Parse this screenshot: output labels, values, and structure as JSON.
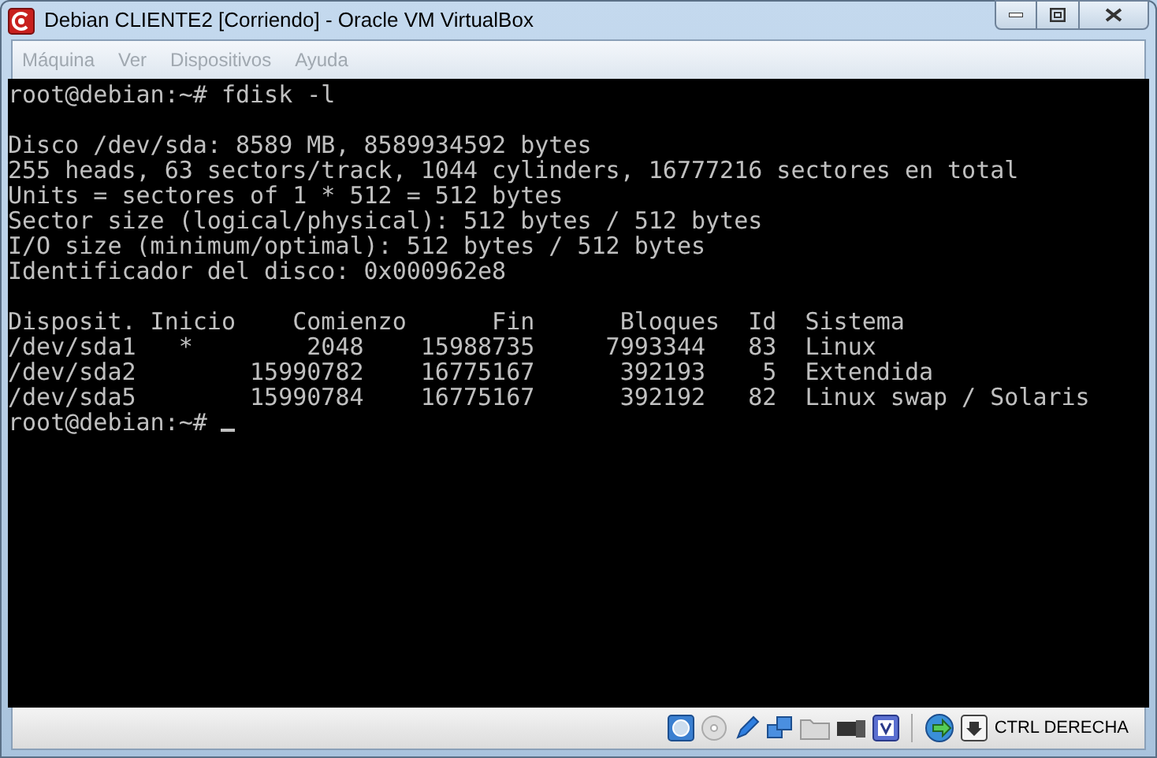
{
  "window": {
    "title": "Debian CLIENTE2 [Corriendo] - Oracle VM VirtualBox"
  },
  "menu": [
    {
      "label": "Máquina",
      "disabled": true
    },
    {
      "label": "Ver",
      "disabled": true
    },
    {
      "label": "Dispositivos",
      "disabled": true
    },
    {
      "label": "Ayuda",
      "disabled": true
    }
  ],
  "terminal": {
    "blocks": [
      [
        "root@debian:~# fdisk -l"
      ],
      [
        "Disco /dev/sda: 8589 MB, 8589934592 bytes",
        "255 heads, 63 sectors/track, 1044 cylinders, 16777216 sectores en total",
        "Units = sectores of 1 * 512 = 512 bytes",
        "Sector size (logical/physical): 512 bytes / 512 bytes",
        "I/O size (minimum/optimal): 512 bytes / 512 bytes",
        "Identificador del disco: 0x000962e8"
      ],
      [
        "Disposit. Inicio    Comienzo      Fin      Bloques  Id  Sistema",
        "/dev/sda1   *        2048    15988735     7993344   83  Linux",
        "/dev/sda2        15990782    16775167      392193    5  Extendida",
        "/dev/sda5        15990784    16775167      392192   82  Linux swap / Solaris",
        "root@debian:~# "
      ]
    ],
    "cursor": true
  },
  "status_bar": {
    "host_key": "CTRL DERECHA"
  }
}
